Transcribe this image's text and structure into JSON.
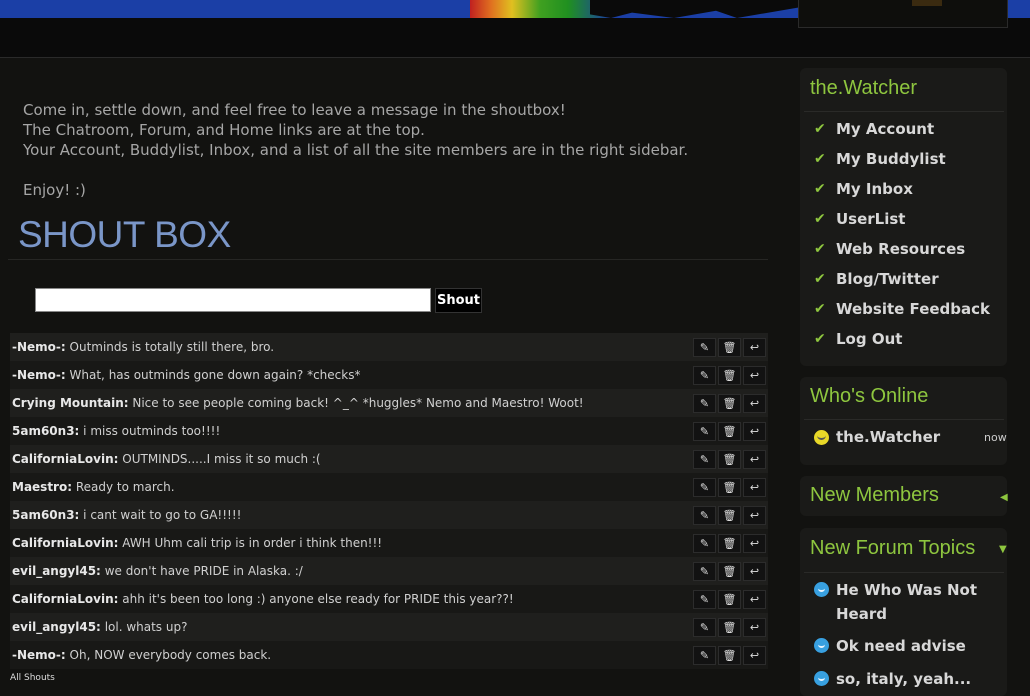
{
  "intro": {
    "lines": [
      "Come in, settle down, and feel free to leave a message in the shoutbox!",
      "The Chatroom, Forum, and Home links are at the top.",
      "Your Account, Buddylist, Inbox, and a list of all the site members are in the right sidebar."
    ],
    "closing": "Enjoy! :)"
  },
  "shoutbox": {
    "title": "SHOUT BOX",
    "input_value": "",
    "shout_button": "Shout",
    "all_shouts_link": "All Shouts",
    "shouts": [
      {
        "user": "-Nemo-:",
        "message": "Outminds is totally still there, bro."
      },
      {
        "user": "-Nemo-:",
        "message": "What, has outminds gone down again? *checks*"
      },
      {
        "user": "Crying Mountain:",
        "message": "Nice to see people coming back! ^_^ *huggles* Nemo and Maestro! Woot!"
      },
      {
        "user": "5am60n3:",
        "message": "i miss outminds too!!!!"
      },
      {
        "user": "CaliforniaLovin:",
        "message": "OUTMINDS.....I miss it so much :("
      },
      {
        "user": "Maestro:",
        "message": "Ready to march."
      },
      {
        "user": "5am60n3:",
        "message": "i cant wait to go to GA!!!!!"
      },
      {
        "user": "CaliforniaLovin:",
        "message": "AWH Uhm cali trip is in order i think then!!!"
      },
      {
        "user": "evil_angyl45:",
        "message": "we don't have PRIDE in Alaska. :/"
      },
      {
        "user": "CaliforniaLovin:",
        "message": "ahh it's been too long :) anyone else ready for PRIDE this year??!"
      },
      {
        "user": "evil_angyl45:",
        "message": "lol. whats up?"
      },
      {
        "user": "-Nemo-:",
        "message": "Oh, NOW everybody comes back."
      }
    ],
    "row_icons": [
      "edit-icon",
      "delete-icon",
      "reply-icon"
    ]
  },
  "sidebar": {
    "user_title": "the.Watcher",
    "menu": [
      "My Account",
      "My Buddylist",
      "My Inbox",
      "UserList",
      "Web Resources",
      "Blog/Twitter",
      "Website Feedback",
      "Log Out"
    ],
    "whos_online": {
      "title": "Who's Online",
      "users": [
        {
          "name": "the.Watcher",
          "time": "now"
        }
      ]
    },
    "new_members": {
      "title": "New Members"
    },
    "new_forum_topics": {
      "title": "New Forum Topics",
      "topics": [
        "He Who Was Not Heard",
        "Ok need advise",
        "so, italy, yeah..."
      ]
    }
  },
  "colors": {
    "accent_green": "#8ec63f",
    "shoutbox_title": "#7a96c8",
    "background": "#121210"
  }
}
